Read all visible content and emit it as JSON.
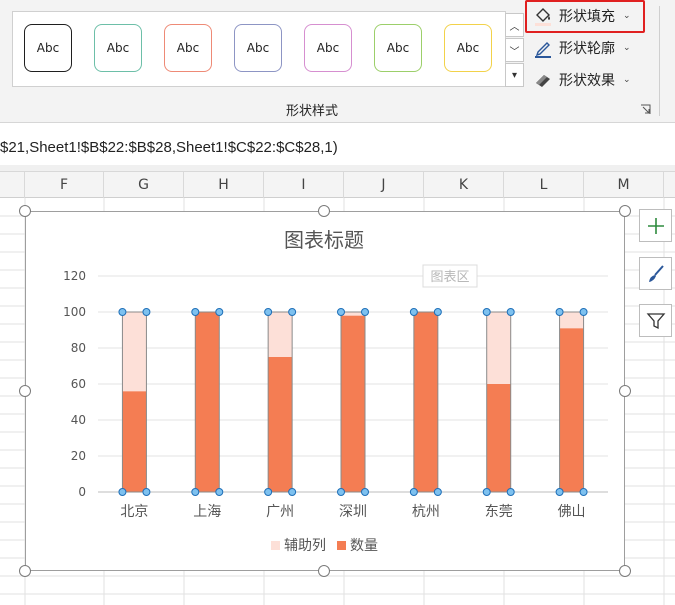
{
  "ribbon": {
    "style_buttons": [
      {
        "label": "Abc",
        "color": "#1f1f1f"
      },
      {
        "label": "Abc",
        "color": "#6dbfa8"
      },
      {
        "label": "Abc",
        "color": "#ee8a76"
      },
      {
        "label": "Abc",
        "color": "#8d95c4"
      },
      {
        "label": "Abc",
        "color": "#d68fd0"
      },
      {
        "label": "Abc",
        "color": "#9ccf6a"
      },
      {
        "label": "Abc",
        "color": "#f2d24a"
      }
    ],
    "shape_fill": "形状填充",
    "shape_outline": "形状轮廓",
    "shape_effects": "形状效果",
    "group_label": "形状样式"
  },
  "formula_bar": {
    "text": "$21,Sheet1!$B$22:$B$28,Sheet1!$C$22:$C$28,1)"
  },
  "columns": [
    "F",
    "G",
    "H",
    "I",
    "J",
    "K",
    "L",
    "M"
  ],
  "chart": {
    "area_tooltip": "图表区"
  },
  "chart_data": {
    "type": "bar",
    "stacked": true,
    "title": "图表标题",
    "categories": [
      "北京",
      "上海",
      "广州",
      "深圳",
      "杭州",
      "东莞",
      "佛山"
    ],
    "series": [
      {
        "name": "数量",
        "values": [
          56,
          100,
          75,
          98,
          100,
          60,
          91
        ],
        "color": "#f47d53"
      },
      {
        "name": "辅助列",
        "values": [
          44,
          0,
          25,
          2,
          0,
          40,
          9
        ],
        "color": "#fde0d8"
      }
    ],
    "ylim": [
      0,
      120
    ],
    "yticks": [
      0,
      20,
      40,
      60,
      80,
      100,
      120
    ],
    "grid": true,
    "legend": "bottom"
  }
}
